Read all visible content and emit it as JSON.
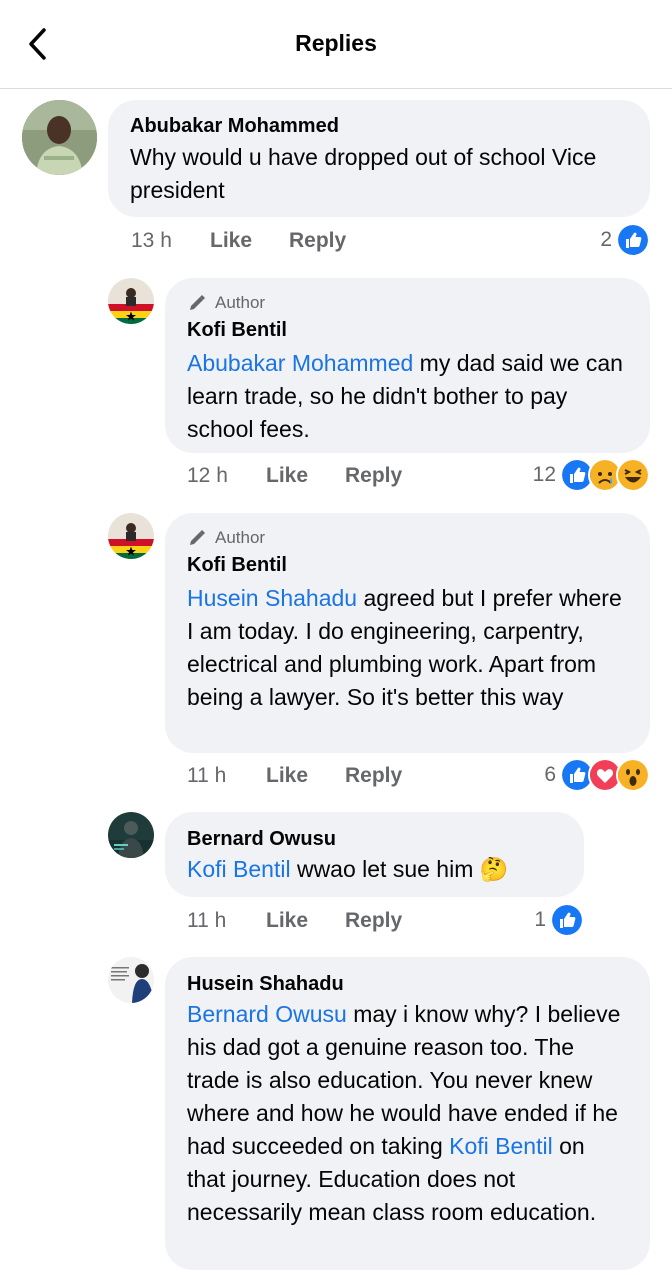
{
  "header": {
    "title": "Replies",
    "back_icon": "chevron-left-icon"
  },
  "colors": {
    "mention": "#1b74e4",
    "bubble": "#f0f2f5",
    "like": "#1877f2",
    "love": "#f33e58",
    "haha": "#f7b125"
  },
  "comments": [
    {
      "name": "Abubakar Mohammed",
      "text": "Why would u have dropped out of school Vice president",
      "time": "13 h",
      "like": "Like",
      "reply": "Reply",
      "reaction_count": "2",
      "reactions": [
        "like"
      ]
    },
    {
      "author_tag": "Author",
      "name": "Kofi Bentil",
      "mention": "Abubakar Mohammed",
      "text": " my dad said we can learn  trade, so he didn't bother to pay school fees.",
      "time": "12 h",
      "like": "Like",
      "reply": "Reply",
      "reaction_count": "12",
      "reactions": [
        "like",
        "sad",
        "haha"
      ]
    },
    {
      "author_tag": "Author",
      "name": "Kofi Bentil",
      "mention": "Husein Shahadu",
      "text": " agreed but I prefer where I am today. I do engineering, carpentry, electrical and plumbing work. Apart from being a lawyer. So it's better this way",
      "time": "11 h",
      "like": "Like",
      "reply": "Reply",
      "reaction_count": "6",
      "reactions": [
        "like",
        "love",
        "wow"
      ]
    },
    {
      "name": "Bernard Owusu",
      "mention": "Kofi Bentil",
      "text": "  wwao  let sue him 🤔",
      "time": "11 h",
      "like": "Like",
      "reply": "Reply",
      "reaction_count": "1",
      "reactions": [
        "like"
      ]
    },
    {
      "name": "Husein Shahadu",
      "mention": "Bernard Owusu",
      "text": " may i know why? I believe his dad got a genuine reason too. The trade is also education. You never knew where and how he would have ended if he had succeeded on taking ",
      "mention2": "Kofi Bentil",
      "text2": " on that journey. Education does not necessarily mean class room education."
    }
  ]
}
